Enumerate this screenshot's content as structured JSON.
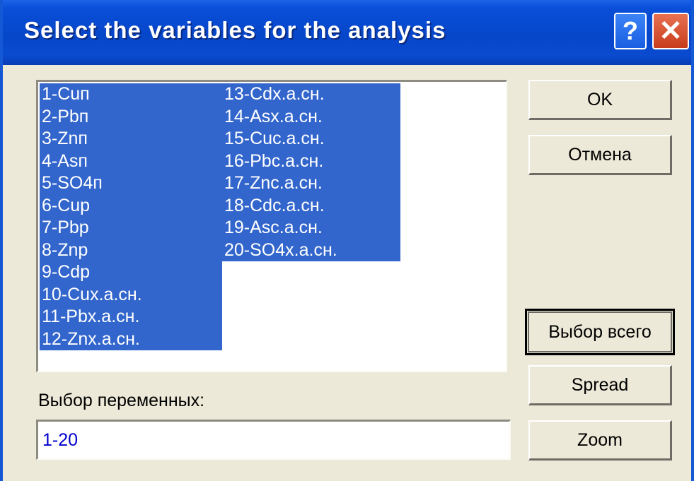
{
  "window": {
    "title": "Select the variables for the analysis",
    "help_label": "?",
    "close_label": "✕"
  },
  "variables": {
    "column1": [
      "1-Cuп",
      "2-Pbп",
      "3-Znп",
      "4-Asп",
      "5-SO4п",
      "6-Cup",
      "7-Pbp",
      "8-Znp",
      "9-Cdp",
      "10-Cux.a.сн.",
      "11-Pbx.a.сн.",
      "12-Znx.a.сн."
    ],
    "column2": [
      "13-Cdx.a.сн.",
      "14-Asx.a.сн.",
      "15-Cuc.a.сн.",
      "16-Pbc.a.сн.",
      "17-Znc.a.сн.",
      "18-Cdc.a.сн.",
      "19-Asc.a.сн.",
      "20-SO4x.a.сн."
    ]
  },
  "buttons": {
    "ok": "OK",
    "cancel": "Отмена",
    "select_all": "Выбор всего",
    "spread": "Spread",
    "zoom": "Zoom"
  },
  "selection": {
    "label": "Выбор переменных:",
    "value": "1-20"
  },
  "colors": {
    "titlebar": "#0646c9",
    "selection_highlight": "#3366cc",
    "dialog_background": "#ece9d8",
    "input_text": "#0000cc"
  }
}
